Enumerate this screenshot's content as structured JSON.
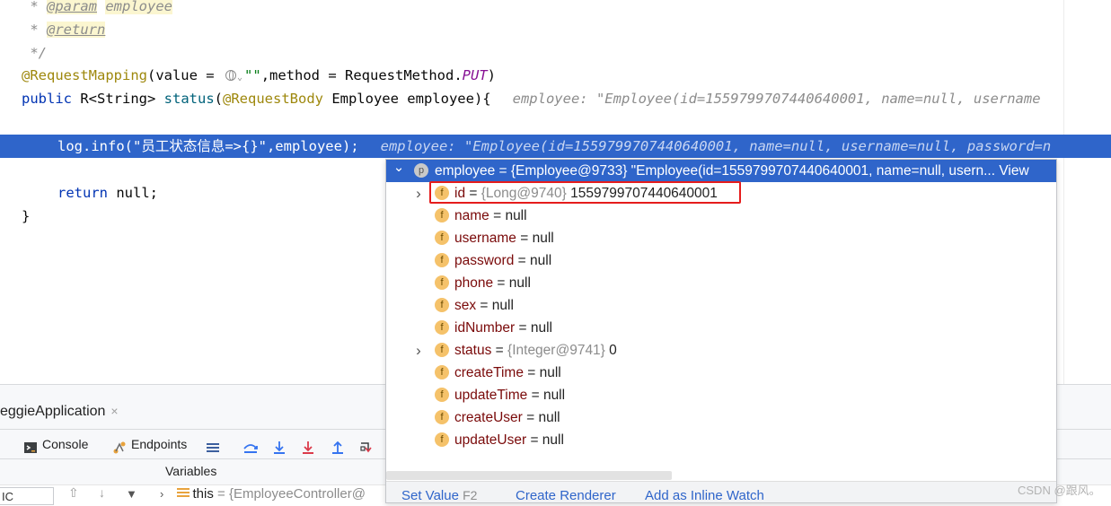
{
  "editor": {
    "lines": {
      "l1": {
        "star": " * ",
        "tag": "@param",
        "sp": " ",
        "word": "employee"
      },
      "l2": {
        "star": " * ",
        "tag": "@return"
      },
      "l3": {
        "text": " */"
      },
      "l4": {
        "ann": "@RequestMapping",
        "p1": "(value = ",
        "str": "\"\"",
        "p2": ",method = RequestMethod.",
        "put": "PUT",
        "p3": ")"
      },
      "l5": {
        "kw": "public",
        "p1": " R<String> ",
        "fn": "status",
        "p2": "(",
        "ann": "@RequestBody",
        "p3": " Employee employee){",
        "hint": "employee: \"Employee(id=1559799707440640001, name=null, username"
      },
      "l7": {
        "code": "log.info(\"员工状态信息=>{}\",employee);",
        "hint": "employee: \"Employee(id=1559799707440640001, name=null, username=null, password=n"
      },
      "l9": {
        "kw": "return",
        "rest": " null;"
      },
      "l10": {
        "text": "}"
      }
    }
  },
  "popup": {
    "root": {
      "name": "employee",
      "value": " = {Employee@9733} \"Employee(id=1559799707440640001, name=null, usern... View",
      "badge": "p"
    },
    "fields": [
      {
        "name": "id",
        "type": "{Long@9740}",
        "value": " 1559799707440640001",
        "expandable": true,
        "badge": "f"
      },
      {
        "name": "name",
        "value": " = null",
        "badge": "f"
      },
      {
        "name": "username",
        "value": " = null",
        "badge": "f"
      },
      {
        "name": "password",
        "value": " = null",
        "badge": "f"
      },
      {
        "name": "phone",
        "value": " = null",
        "badge": "f"
      },
      {
        "name": "sex",
        "value": " = null",
        "badge": "f"
      },
      {
        "name": "idNumber",
        "value": " = null",
        "badge": "f"
      },
      {
        "name": "status",
        "type": "{Integer@9741}",
        "value": " 0",
        "expandable": true,
        "badge": "f"
      },
      {
        "name": "createTime",
        "value": " = null",
        "badge": "f"
      },
      {
        "name": "updateTime",
        "value": " = null",
        "badge": "f"
      },
      {
        "name": "createUser",
        "value": " = null",
        "badge": "f"
      },
      {
        "name": "updateUser",
        "value": " = null",
        "badge": "f"
      }
    ],
    "footer": {
      "set_value": "Set Value",
      "set_value_key": "F2",
      "create_renderer": "Create Renderer",
      "add_inline_watch": "Add as Inline Watch"
    }
  },
  "tool_window": {
    "run_tab": "eggieApplication",
    "close": "×",
    "console": "Console",
    "endpoints": "Endpoints",
    "variables": "Variables",
    "frame_field": "IC",
    "this_row": {
      "name": "this",
      "value": " = {EmployeeController@"
    }
  },
  "watermark": "CSDN @跟风。",
  "colors": {
    "selection": "#2f65ca",
    "highlight_box": "#e51c1c",
    "field_badge": "#f5c26a"
  }
}
